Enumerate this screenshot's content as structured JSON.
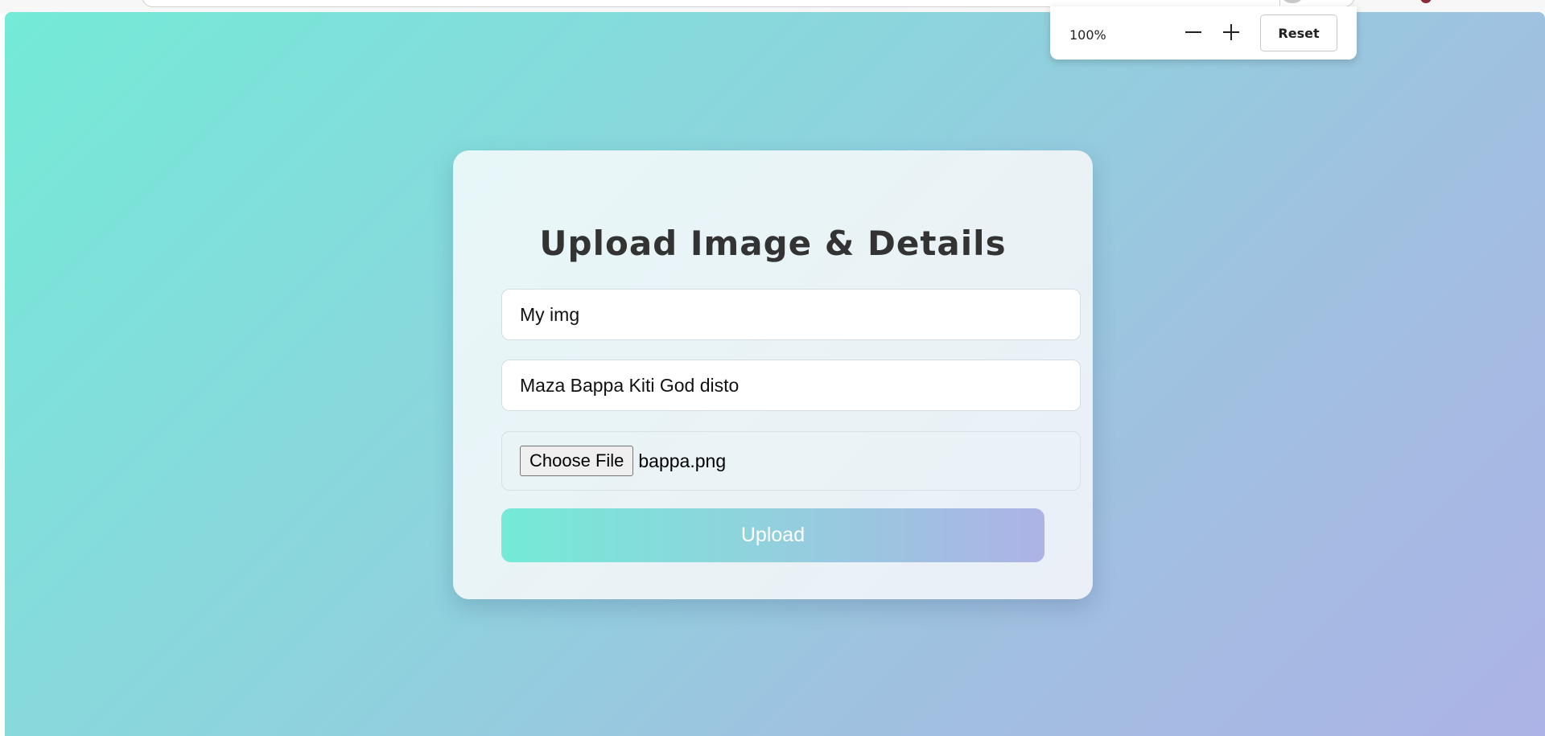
{
  "browser": {
    "zoom": {
      "level": "100%",
      "minus_icon": "minus-icon",
      "plus_icon": "plus-icon",
      "reset_label": "Reset"
    }
  },
  "page": {
    "background_colors": [
      "#74ead7",
      "#adb3e6"
    ],
    "card": {
      "title": "Upload Image & Details",
      "title_field": {
        "value": "My img"
      },
      "description_field": {
        "value": "Maza Bappa Kiti God disto"
      },
      "file_input": {
        "button_label": "Choose File",
        "file_name": "bappa.png"
      },
      "upload_label": "Upload"
    }
  }
}
